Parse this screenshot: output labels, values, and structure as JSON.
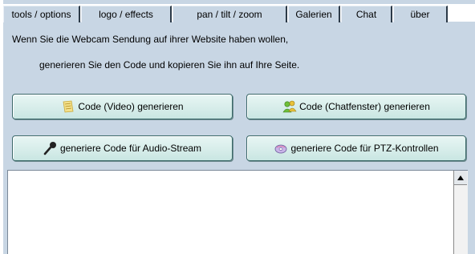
{
  "tabs": [
    {
      "label": "tools / options"
    },
    {
      "label": "logo / effects"
    },
    {
      "label": "pan / tilt / zoom"
    },
    {
      "label": "Galerien"
    },
    {
      "label": "Chat"
    },
    {
      "label": "über"
    }
  ],
  "description": {
    "line1": "Wenn Sie die Webcam Sendung auf ihrer Website haben wollen,",
    "line2": "generieren Sie den Code und kopieren Sie ihn auf Ihre Seite."
  },
  "buttons": {
    "video_code": "Code (Video) generieren",
    "chat_code": "Code (Chatfenster) generieren",
    "audio_code": "generiere Code für Audio-Stream",
    "ptz_code": "generiere Code für PTZ-Kontrollen"
  },
  "icons": {
    "video": "notepad-icon",
    "chat": "people-icon",
    "audio": "microphone-icon",
    "ptz": "disc-icon"
  },
  "code_output": {
    "value": ""
  }
}
